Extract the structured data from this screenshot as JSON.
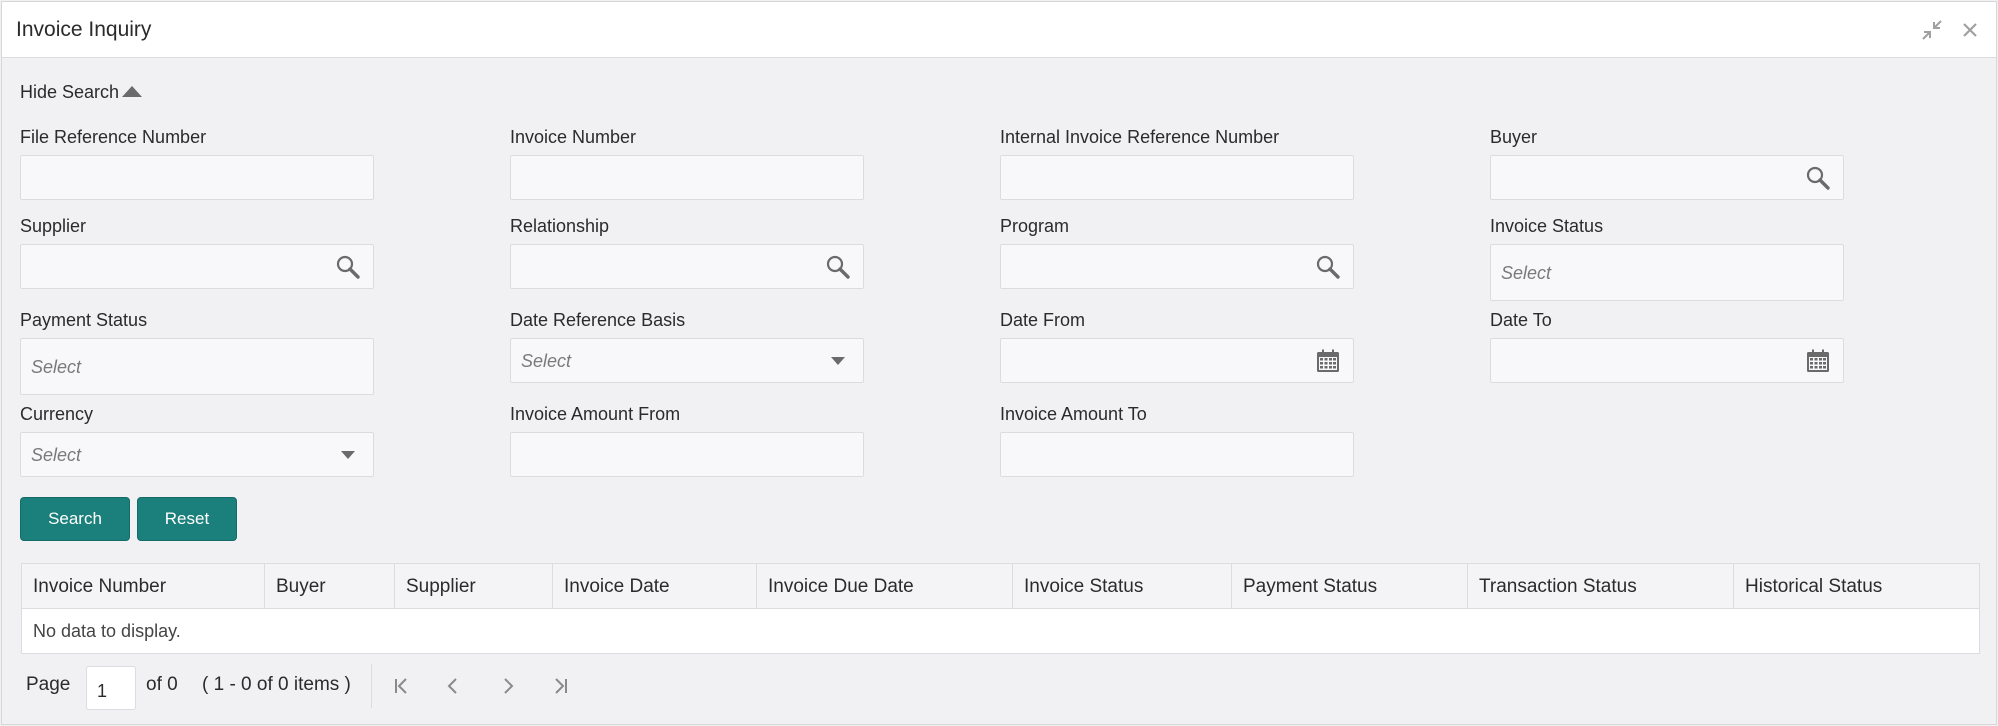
{
  "window": {
    "title": "Invoice Inquiry"
  },
  "search": {
    "toggle_label": "Hide Search",
    "fields": {
      "file_reference_number": {
        "label": "File Reference Number"
      },
      "invoice_number": {
        "label": "Invoice Number"
      },
      "internal_invoice_reference_number": {
        "label": "Internal Invoice Reference Number"
      },
      "buyer": {
        "label": "Buyer"
      },
      "supplier": {
        "label": "Supplier"
      },
      "relationship": {
        "label": "Relationship"
      },
      "program": {
        "label": "Program"
      },
      "invoice_status": {
        "label": "Invoice Status",
        "placeholder": "Select"
      },
      "payment_status": {
        "label": "Payment Status",
        "placeholder": "Select"
      },
      "date_reference_basis": {
        "label": "Date Reference Basis",
        "placeholder": "Select"
      },
      "date_from": {
        "label": "Date From"
      },
      "date_to": {
        "label": "Date To"
      },
      "currency": {
        "label": "Currency",
        "placeholder": "Select"
      },
      "invoice_amount_from": {
        "label": "Invoice Amount From"
      },
      "invoice_amount_to": {
        "label": "Invoice Amount To"
      }
    },
    "buttons": {
      "search": "Search",
      "reset": "Reset"
    }
  },
  "results": {
    "columns": [
      "Invoice Number",
      "Buyer",
      "Supplier",
      "Invoice Date",
      "Invoice Due Date",
      "Invoice Status",
      "Payment Status",
      "Transaction Status",
      "Historical Status"
    ],
    "empty_message": "No data to display."
  },
  "pagination": {
    "page_label": "Page",
    "current_page": "1",
    "of_label": "of 0",
    "items_summary": "( 1 - 0 of 0 items )"
  },
  "colors": {
    "accent": "#1b7f7b",
    "background": "#f1f1f3",
    "icon": "#6a6a6a"
  }
}
